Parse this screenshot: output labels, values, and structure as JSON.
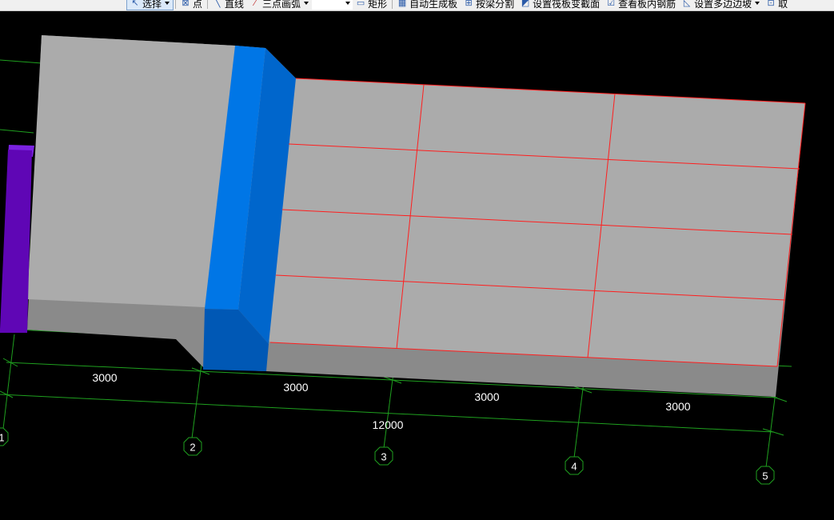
{
  "toolbar": {
    "items": [
      {
        "label": "选择",
        "icon": "pointer-icon",
        "active": true,
        "dropdown": true
      },
      {
        "label": "点",
        "icon": "point-icon"
      },
      {
        "label": "直线",
        "icon": "line-icon"
      },
      {
        "label": "三点画弧",
        "icon": "arc-icon",
        "dropdown": true
      },
      {
        "label": "矩形",
        "icon": "rectangle-icon"
      },
      {
        "label": "自动生成板",
        "icon": "auto-slab-icon"
      },
      {
        "label": "按梁分割",
        "icon": "split-by-beam-icon"
      },
      {
        "label": "设置筏板变截面",
        "icon": "variable-section-icon"
      },
      {
        "label": "查看板内钢筋",
        "icon": "view-rebar-icon"
      },
      {
        "label": "设置多边边坡",
        "icon": "slope-icon",
        "dropdown": true
      },
      {
        "label": "取",
        "icon": "pick-icon"
      }
    ]
  },
  "dimensions": {
    "spans": [
      "3000",
      "3000",
      "3000",
      "3000"
    ],
    "total": "12000"
  },
  "axes": [
    "1",
    "2",
    "3",
    "4",
    "5"
  ],
  "colors": {
    "background": "#000000",
    "slab_top": "#ababab",
    "slab_side": "#8a8a8a",
    "beam_front": "#0076e6",
    "beam_side": "#0066cc",
    "column": "#5f06b5",
    "rebar_grid": "#ff1e1e",
    "axis_lines": "#1fa01f"
  }
}
